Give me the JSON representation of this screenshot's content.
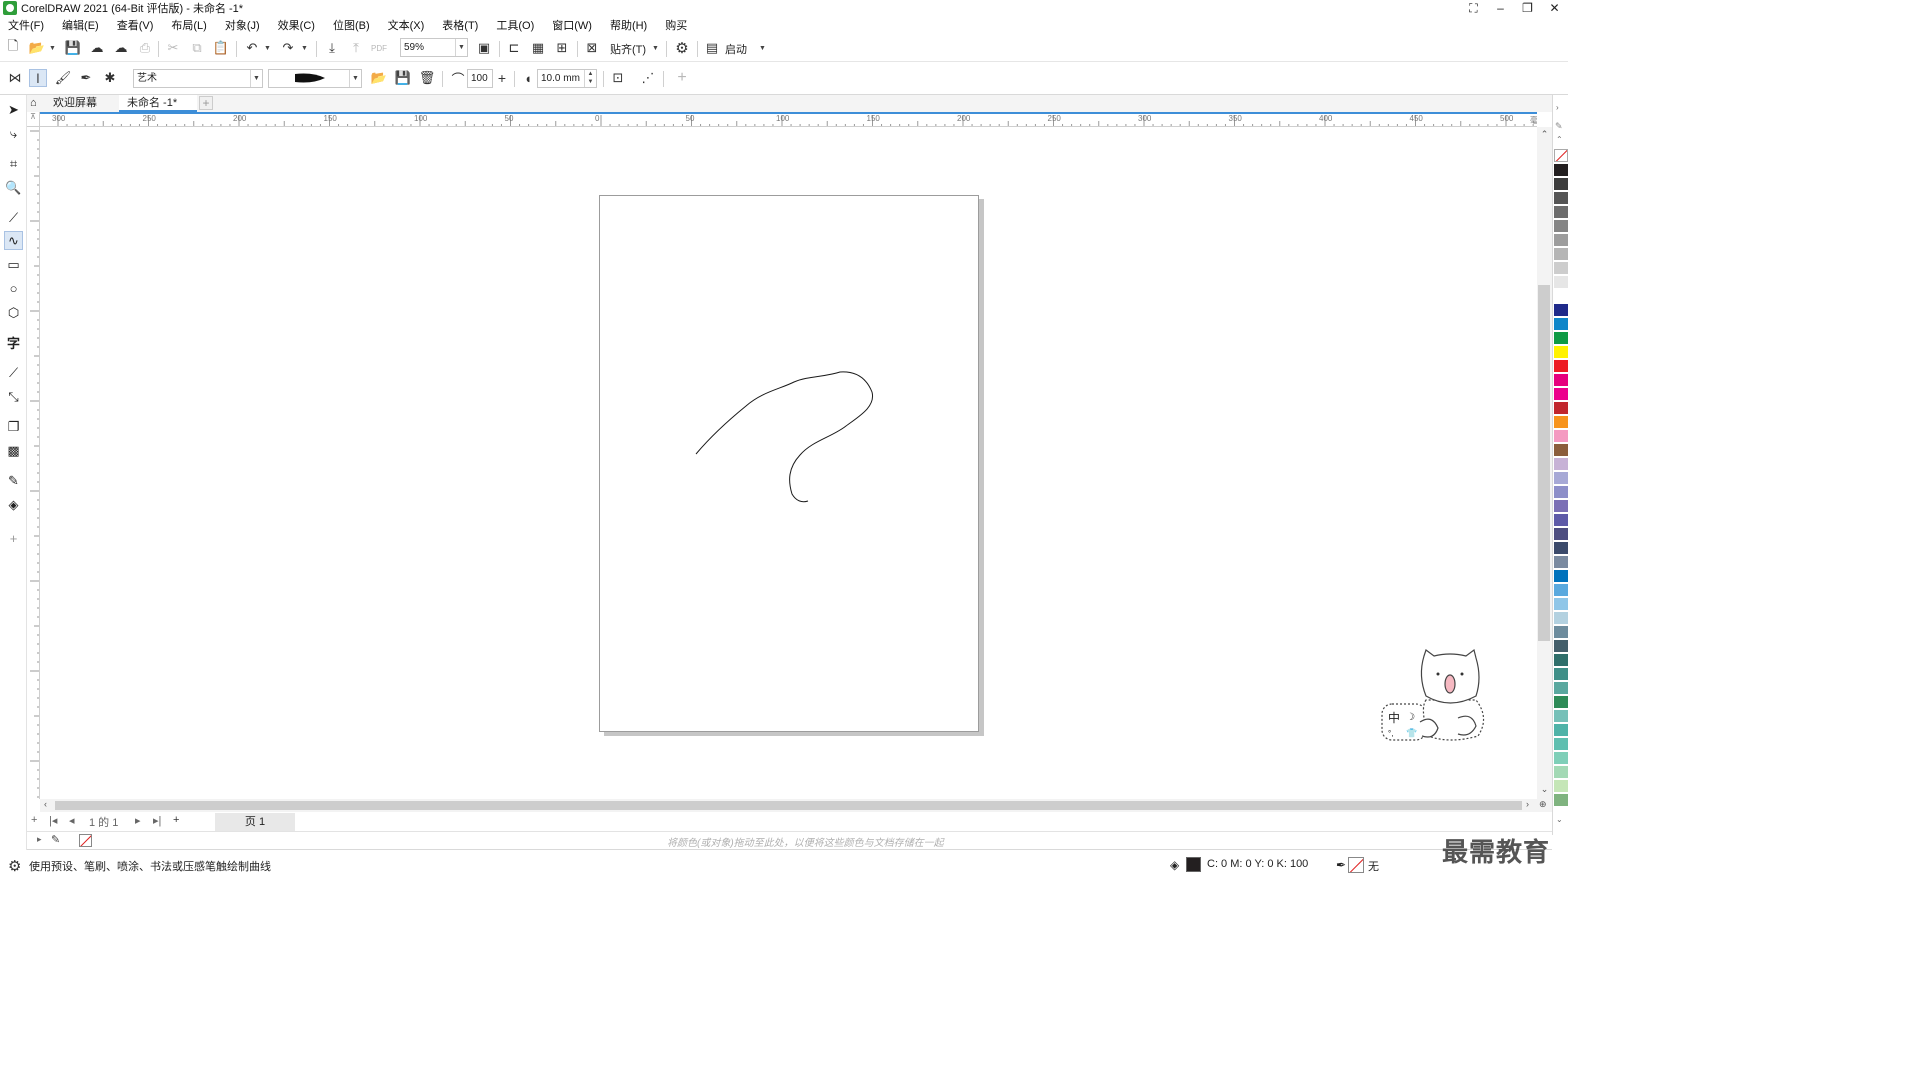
{
  "window": {
    "title": "CorelDRAW 2021 (64-Bit 评估版) - 未命名 -1*"
  },
  "menu": [
    "文件(F)",
    "编辑(E)",
    "查看(V)",
    "布局(L)",
    "对象(J)",
    "效果(C)",
    "位图(B)",
    "文本(X)",
    "表格(T)",
    "工具(O)",
    "窗口(W)",
    "帮助(H)",
    "购买"
  ],
  "toolbar": {
    "zoom": "59%",
    "snap_label": "贴齐(T)",
    "launch_label": "启动"
  },
  "property_bar": {
    "preset_category": "艺术",
    "smoothing": "100",
    "stroke_width": "10.0 mm"
  },
  "tabs": [
    {
      "label": "欢迎屏幕"
    },
    {
      "label": "未命名 -1*"
    }
  ],
  "ruler": {
    "h_labels": [
      "300",
      "250",
      "200",
      "150",
      "100",
      "50",
      "0",
      "50",
      "100",
      "150",
      "200",
      "250",
      "300",
      "350",
      "400",
      "450",
      "500"
    ],
    "unit": "毫米"
  },
  "page_nav": {
    "page_count": "1 的 1",
    "page_tab": "页 1"
  },
  "doc_palette": {
    "hint": "将颜色(或对象)拖动至此处，以便将这些颜色与文档存储在一起"
  },
  "status": {
    "message": "使用预设、笔刷、喷涂、书法或压感笔触绘制曲线",
    "fill_values": "C:  0 M:  0 Y:  0 K:  100",
    "outline_label": "无"
  },
  "palette_colors": [
    "#231f20",
    "#3d3d3d",
    "#555555",
    "#6d6d6d",
    "#858585",
    "#9d9d9d",
    "#b5b5b5",
    "#cdcdcd",
    "#e6e6e6",
    "#ffffff",
    "#1f2a8a",
    "#0f86c9",
    "#0e9a44",
    "#fff200",
    "#ed1c24",
    "#e6007e",
    "#ec008c",
    "#c1272d",
    "#f7941d",
    "#f49ac1",
    "#8b5e3c",
    "#c7b2d6",
    "#a7a9d6",
    "#8d8fc9",
    "#7b6fb5",
    "#5e5aa8",
    "#4d4d80",
    "#3b4a6b",
    "#7a8aa0",
    "#0072bc",
    "#5aa9de",
    "#8fc6e8",
    "#b3d1e0",
    "#6d8c9d",
    "#445f6b",
    "#2f6f6b",
    "#3f8f88",
    "#5aa89f",
    "#2e8b57",
    "#76c0b8",
    "#4fb3a8",
    "#5fbfb0",
    "#7fcfb8",
    "#a3d9b5",
    "#c5e6b7",
    "#7fb37f"
  ],
  "watermark": "最需教育",
  "mascot_label": "中"
}
